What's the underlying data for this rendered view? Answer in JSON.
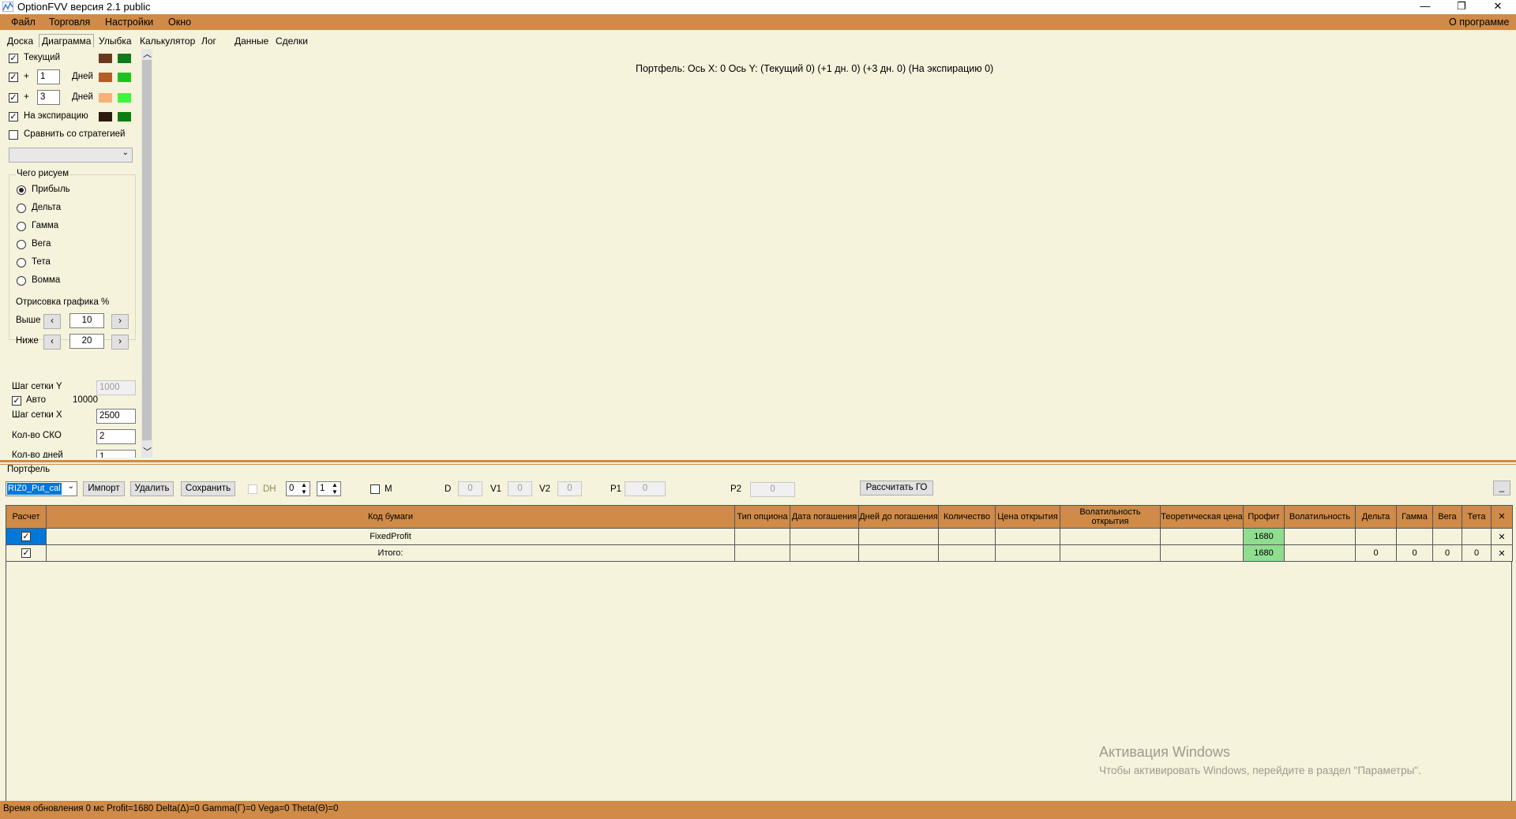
{
  "window": {
    "title": "OptionFVV версия 2.1 public",
    "minimize": "—",
    "restore": "❐",
    "close": "✕"
  },
  "menu": {
    "items": [
      "Файл",
      "Торговля",
      "Настройки",
      "Окно"
    ],
    "about": "О программе"
  },
  "tabs": [
    "Доска",
    "Диаграмма",
    "Улыбка",
    "Калькулятор",
    "Лог",
    "Данные",
    "Сделки"
  ],
  "active_tab": "Диаграмма",
  "left_panel": {
    "rows": [
      {
        "checked": true,
        "label": "Текущий",
        "colors": [
          "#6b3a1c",
          "#0f7a1a"
        ]
      },
      {
        "checked": true,
        "prefix": "+",
        "days": "1",
        "unit": "Дней",
        "colors": [
          "#b35e26",
          "#21c021"
        ]
      },
      {
        "checked": true,
        "prefix": "+",
        "days": "3",
        "unit": "Дней",
        "colors": [
          "#f7b27a",
          "#3df53d"
        ]
      },
      {
        "checked": true,
        "label": "На экспирацию",
        "colors": [
          "#2b1a0e",
          "#0d7d12"
        ]
      }
    ],
    "compare_label": "Сравнить со стратегией",
    "compare_checked": false,
    "draw_group_title": "Чего рисуем",
    "draw_options": [
      "Прибыль",
      "Дельта",
      "Гамма",
      "Вега",
      "Тета",
      "Вомма"
    ],
    "draw_selected": "Прибыль",
    "render_group_title": "Отрисовка графика %",
    "above_label": "Выше",
    "above_value": "10",
    "below_label": "Ниже",
    "below_value": "20",
    "grid_y_label": "Шаг сетки Y",
    "grid_y_value": "1000",
    "auto_label": "Авто",
    "auto_checked": true,
    "auto_value": "10000",
    "grid_x_label": "Шаг сетки X",
    "grid_x_value": "2500",
    "sko_label": "Кол-во СКО",
    "sko_value": "2",
    "days_label": "Кол-во дней",
    "days_value": "1"
  },
  "chart": {
    "header": "Портфель: Ось X: 0 Ось Y:  (Текущий 0)  (+1 дн. 0)  (+3 дн. 0)  (На экспирацию 0)"
  },
  "portfolio": {
    "title": "Портфель",
    "select_value": "RIZ0_Put_cal",
    "import_label": "Импорт",
    "delete_label": "Удалить",
    "save_label": "Сохранить",
    "dh_label": "DH",
    "spin1": "0",
    "spin2": "1",
    "m_label": "M",
    "d_label": "D",
    "d_value": "0",
    "v1_label": "V1",
    "v1_value": "0",
    "v2_label": "V2",
    "v2_value": "0",
    "p1_label": "P1",
    "p1_value": "0",
    "p2_label": "P2",
    "p2_value": "0",
    "calc_go_label": "Рассчитать ГО",
    "minimize_label": "_"
  },
  "table": {
    "headers": [
      "Расчет",
      "Код бумаги",
      "Тип опциона",
      "Дата погашения",
      "Дней до погашения",
      "Количество",
      "Цена открытия",
      "Волатильность открытия",
      "Теоретическая цена",
      "Профит",
      "Волатильность",
      "Дельта",
      "Гамма",
      "Вега",
      "Тета",
      "✕"
    ],
    "rows": [
      {
        "checked": true,
        "code": "FixedProfit",
        "profit": "1680",
        "delta": "",
        "gamma": "",
        "vega": "",
        "theta": "",
        "remove": "✕"
      },
      {
        "checked": true,
        "code": "Итого:",
        "profit": "1680",
        "delta": "0",
        "gamma": "0",
        "vega": "0",
        "theta": "0",
        "remove": "✕"
      }
    ]
  },
  "status": {
    "text": "Время обновления 0 мс  Profit=1680 Delta(Δ)=0 Gamma(Γ)=0 Vega=0 Theta(Θ)=0"
  },
  "watermark": {
    "line1": "Активация Windows",
    "line2": "Чтобы активировать Windows, перейдите в раздел \"Параметры\"."
  }
}
